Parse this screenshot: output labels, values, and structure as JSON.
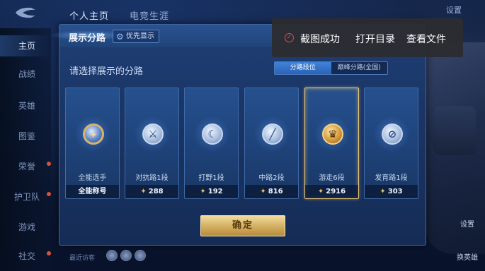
{
  "top_tabs": {
    "profile": "个人主页",
    "esports": "电竞生涯",
    "settings": "设置"
  },
  "sidebar": {
    "items": [
      {
        "label": "主页",
        "active": true
      },
      {
        "label": "战绩",
        "active": false
      },
      {
        "label": "英雄",
        "active": false
      },
      {
        "label": "图鉴",
        "active": false
      },
      {
        "label": "荣誉",
        "active": false
      },
      {
        "label": "护卫队",
        "active": false
      },
      {
        "label": "游戏",
        "active": false
      },
      {
        "label": "社交",
        "active": false
      }
    ]
  },
  "panel": {
    "title": "展示分路",
    "priority_button": "优先显示",
    "subtitle": "请选择展示的分路",
    "segments": [
      "分路段位",
      "巅峰分路(全国)"
    ],
    "active_segment": 0,
    "cards": [
      {
        "label": "全能选手",
        "value": "全能称号",
        "emblem": "overall-emblem",
        "selected": false
      },
      {
        "label": "对抗路1段",
        "value": "288",
        "emblem": "clash-lane-emblem",
        "selected": false
      },
      {
        "label": "打野1段",
        "value": "192",
        "emblem": "jungle-emblem",
        "selected": false
      },
      {
        "label": "中路2段",
        "value": "816",
        "emblem": "mid-lane-emblem",
        "selected": false
      },
      {
        "label": "游走6段",
        "value": "2916",
        "emblem": "roam-emblem",
        "selected": true
      },
      {
        "label": "发育路1段",
        "value": "303",
        "emblem": "farm-lane-emblem",
        "selected": false
      }
    ],
    "confirm": "确定"
  },
  "bottom": {
    "visitors": "最近访客",
    "swap_hero": "换英雄",
    "side_label": "设置"
  },
  "toast": {
    "message": "截图成功",
    "open_dir": "打开目录",
    "view_file": "查看文件"
  },
  "colors": {
    "accent_gold": "#e6c57a",
    "panel_blue": "#1a3566",
    "toast_bg": "#2c2c30",
    "check_red": "#e24848"
  }
}
